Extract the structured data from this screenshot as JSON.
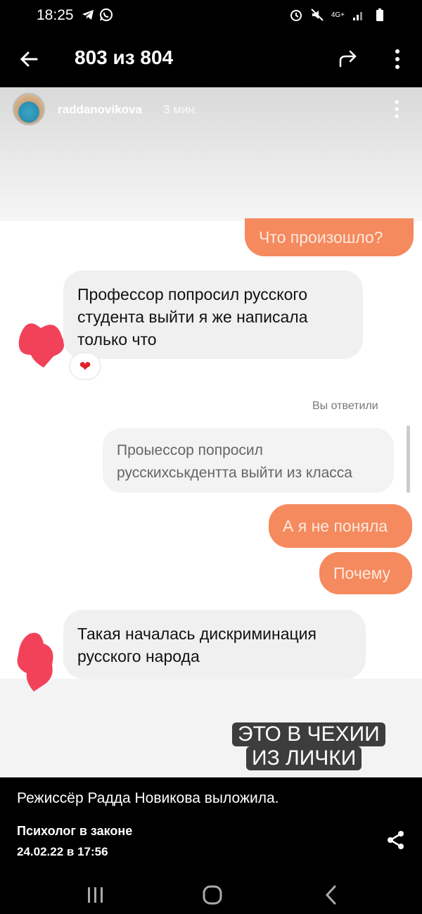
{
  "status_bar": {
    "time": "18:25",
    "network": "4G+"
  },
  "top_bar": {
    "counter": "803 из 804"
  },
  "story": {
    "username": "raddanovikova",
    "time_ago": "3 мин.",
    "messages": {
      "m1": "Что произошло?",
      "m2_line1": "Профессор попросил русского",
      "m2_line2": "студента выйти я же написала",
      "m2_line3": "только что",
      "reaction": "❤",
      "replied_label": "Вы ответили",
      "quote_line1": "Проыессор попросил",
      "quote_line2": "русскихськдентта выйти из класса",
      "m3": "А я не поняла",
      "m4": "Почему",
      "m5_line1": "Такая началась дискриминация",
      "m5_line2": "русского народа"
    },
    "caption_line1": "ЭТО В ЧЕХИИ",
    "caption_line2": "ИЗ ЛИЧКИ"
  },
  "bottom": {
    "description": "Режиссёр Радда Новикова выложила.",
    "author": "Психолог в законе",
    "date": "24.02.22 в 17:56"
  },
  "colors": {
    "orange_bubble": "#f58a5e",
    "gray_bubble": "#f0f0f0",
    "blob": "#f2425a"
  }
}
